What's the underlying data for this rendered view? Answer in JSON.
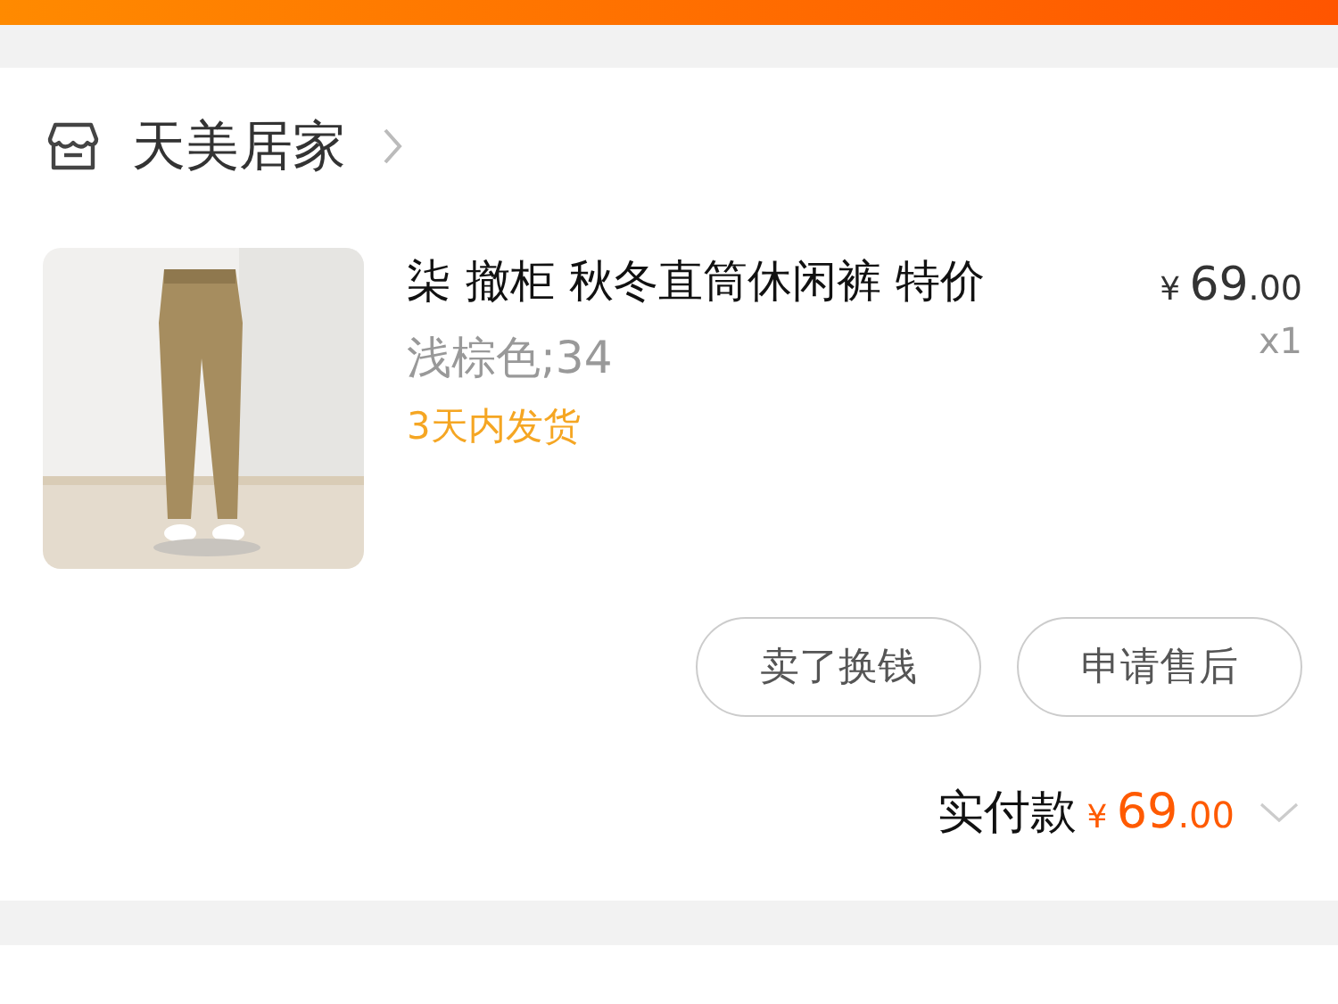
{
  "shop": {
    "name": "天美居家"
  },
  "item": {
    "title": "柒 撤柜 秋冬直筒休闲裤 特价",
    "variant": "浅棕色;34",
    "shipping": "3天内发货",
    "price": {
      "currency": "¥",
      "integer": "69",
      "decimal": ".00"
    },
    "quantity": "x1"
  },
  "actions": [
    {
      "label": "卖了换钱"
    },
    {
      "label": "申请售后"
    }
  ],
  "total": {
    "label": "实付款",
    "price": {
      "currency": "¥",
      "integer": "69",
      "decimal": ".00"
    }
  }
}
